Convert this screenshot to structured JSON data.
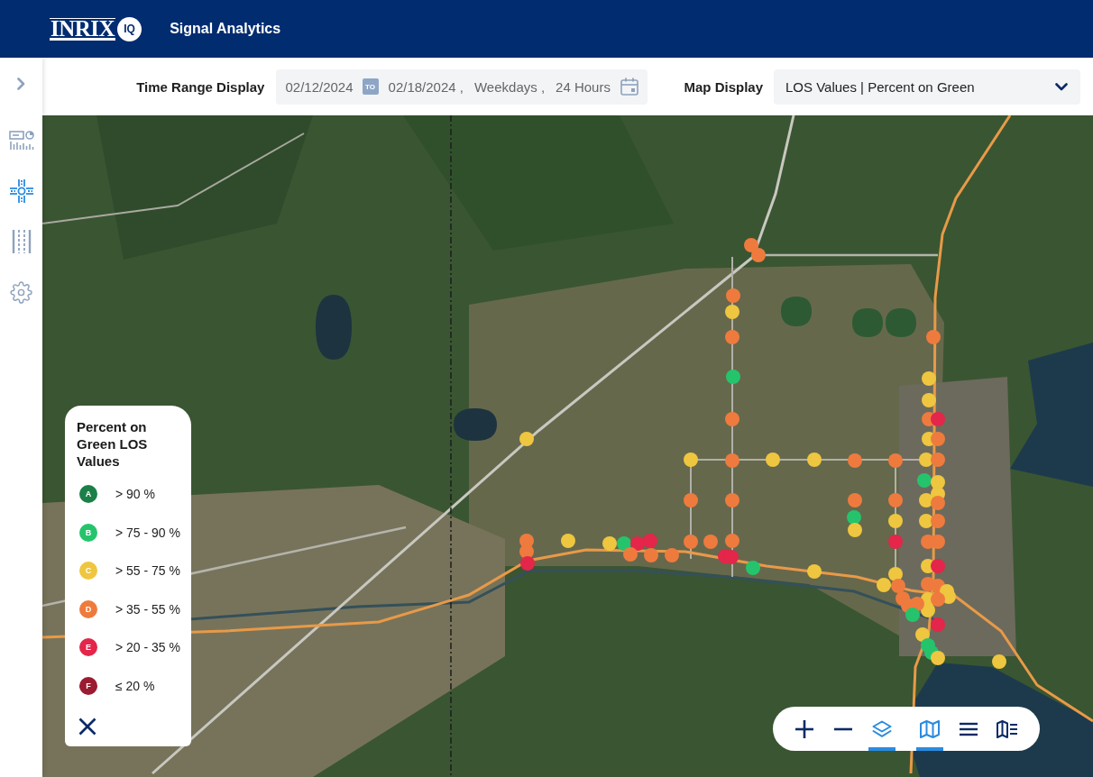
{
  "header": {
    "logo_text": "INRIX",
    "logo_badge": "IQ",
    "title": "Signal Analytics"
  },
  "sidebar": {
    "items": [
      {
        "kind": "dashboard",
        "selected": false
      },
      {
        "kind": "intersection",
        "selected": true
      },
      {
        "kind": "corridor",
        "selected": false
      },
      {
        "kind": "settings",
        "selected": false
      }
    ]
  },
  "filters": {
    "time_range": {
      "label": "Time Range Display",
      "start": "02/12/2024",
      "separator": "TO",
      "end": "02/18/2024 ,",
      "days": "Weekdays ,",
      "hours": "24 Hours"
    },
    "map_display": {
      "label": "Map Display",
      "value": "LOS Values | Percent on Green"
    }
  },
  "map": {
    "markers": [
      {
        "color": "#ee7b3d"
      },
      {
        "color": "#ee7b3d"
      },
      {
        "color": "#ee7b3d"
      },
      {
        "color": "#efc63f"
      },
      {
        "color": "#ee7b3d"
      },
      {
        "color": "#25c46c"
      },
      {
        "color": "#ee7b3d"
      },
      {
        "color": "#ee7b3d"
      },
      {
        "color": "#ee7b3d"
      },
      {
        "color": "#ee7b3d"
      },
      {
        "color": "#efc63f"
      },
      {
        "color": "#efc63f"
      },
      {
        "color": "#efc63f"
      },
      {
        "color": "#ee7b3d"
      },
      {
        "color": "#ee7b3d"
      },
      {
        "color": "#ee7b3d"
      },
      {
        "color": "#ee7b3d"
      },
      {
        "color": "#efc63f"
      },
      {
        "color": "#ee7b3d"
      },
      {
        "color": "#ee7b3d"
      },
      {
        "color": "#e3264a"
      },
      {
        "color": "#efc63f"
      },
      {
        "color": "#efc63f"
      },
      {
        "color": "#25c46c"
      },
      {
        "color": "#e3264a"
      },
      {
        "color": "#e3264a"
      },
      {
        "color": "#ee7b3d"
      },
      {
        "color": "#ee7b3d"
      },
      {
        "color": "#ee7b3d"
      },
      {
        "color": "#ee7b3d"
      },
      {
        "color": "#e3264a"
      },
      {
        "color": "#e3264a"
      },
      {
        "color": "#25c46c"
      },
      {
        "color": "#efc63f"
      },
      {
        "color": "#ee7b3d"
      },
      {
        "color": "#25c46c"
      },
      {
        "color": "#efc63f"
      },
      {
        "color": "#ee7b3d"
      },
      {
        "color": "#efc63f"
      },
      {
        "color": "#e3264a"
      },
      {
        "color": "#efc63f"
      },
      {
        "color": "#efc63f"
      },
      {
        "color": "#ee7b3d"
      },
      {
        "color": "#ee7b3d"
      },
      {
        "color": "#ee7b3d"
      },
      {
        "color": "#ee7b3d"
      },
      {
        "color": "#efc63f"
      },
      {
        "color": "#efc63f"
      },
      {
        "color": "#ee7b3d"
      },
      {
        "color": "#e3264a"
      },
      {
        "color": "#efc63f"
      },
      {
        "color": "#ee7b3d"
      },
      {
        "color": "#efc63f"
      },
      {
        "color": "#ee7b3d"
      },
      {
        "color": "#25c46c"
      },
      {
        "color": "#efc63f"
      },
      {
        "color": "#efc63f"
      },
      {
        "color": "#efc63f"
      },
      {
        "color": "#ee7b3d"
      },
      {
        "color": "#efc63f"
      },
      {
        "color": "#ee7b3d"
      },
      {
        "color": "#ee7b3d"
      },
      {
        "color": "#ee7b3d"
      },
      {
        "color": "#efc63f"
      },
      {
        "color": "#e3264a"
      },
      {
        "color": "#ee7b3d"
      },
      {
        "color": "#ee7b3d"
      },
      {
        "color": "#efc63f"
      },
      {
        "color": "#efc63f"
      },
      {
        "color": "#efc63f"
      },
      {
        "color": "#ee7b3d"
      },
      {
        "color": "#efc63f"
      },
      {
        "color": "#ee7b3d"
      },
      {
        "color": "#25c46c"
      },
      {
        "color": "#e3264a"
      },
      {
        "color": "#efc63f"
      },
      {
        "color": "#25c46c"
      },
      {
        "color": "#25c46c"
      },
      {
        "color": "#efc63f"
      },
      {
        "color": "#efc63f"
      }
    ]
  },
  "legend": {
    "title": "Percent on Green LOS Values",
    "items": [
      {
        "grade": "A",
        "label": "> 90 %",
        "color": "#1b7f48"
      },
      {
        "grade": "B",
        "label": "> 75 - 90 %",
        "color": "#25c46c"
      },
      {
        "grade": "C",
        "label": "> 55 - 75 %",
        "color": "#efc63f"
      },
      {
        "grade": "D",
        "label": "> 35 - 55 %",
        "color": "#ee7b3d"
      },
      {
        "grade": "E",
        "label": "> 20 - 35 %",
        "color": "#e3264a"
      },
      {
        "grade": "F",
        "label": "≤ 20 %",
        "color": "#9b1b30"
      }
    ]
  },
  "map_controls": [
    {
      "kind": "zoom-in",
      "selected": false
    },
    {
      "kind": "zoom-out",
      "selected": false
    },
    {
      "kind": "layers",
      "selected": true
    },
    {
      "kind": "map",
      "selected": true
    },
    {
      "kind": "list",
      "selected": false
    },
    {
      "kind": "legend",
      "selected": false
    }
  ]
}
